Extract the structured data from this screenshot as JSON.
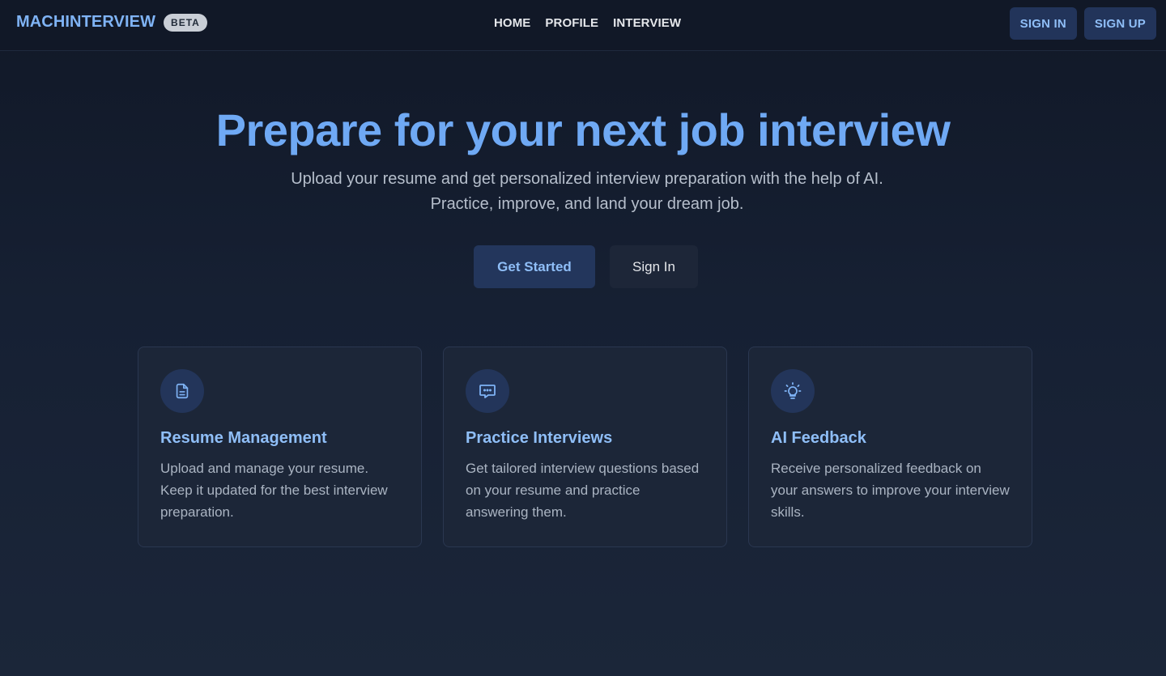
{
  "header": {
    "brand": "MACHINTERVIEW",
    "badge": "BETA",
    "nav": [
      "HOME",
      "PROFILE",
      "INTERVIEW"
    ],
    "sign_in": "SIGN IN",
    "sign_up": "SIGN UP"
  },
  "hero": {
    "title": "Prepare for your next job interview",
    "subtitle": "Upload your resume and get personalized interview preparation with the help of AI. Practice, improve, and land your dream job.",
    "primary_cta": "Get Started",
    "secondary_cta": "Sign In"
  },
  "features": [
    {
      "icon": "document-icon",
      "title": "Resume Management",
      "description": "Upload and manage your resume. Keep it updated for the best interview preparation."
    },
    {
      "icon": "chat-icon",
      "title": "Practice Interviews",
      "description": "Get tailored interview questions based on your resume and practice answering them."
    },
    {
      "icon": "lightbulb-icon",
      "title": "AI Feedback",
      "description": "Receive personalized feedback on your answers to improve your interview skills."
    }
  ],
  "colors": {
    "accent": "#6fa9f4",
    "accent_light": "#8fbef7",
    "button_bg": "#23365c",
    "background": "#111827"
  }
}
